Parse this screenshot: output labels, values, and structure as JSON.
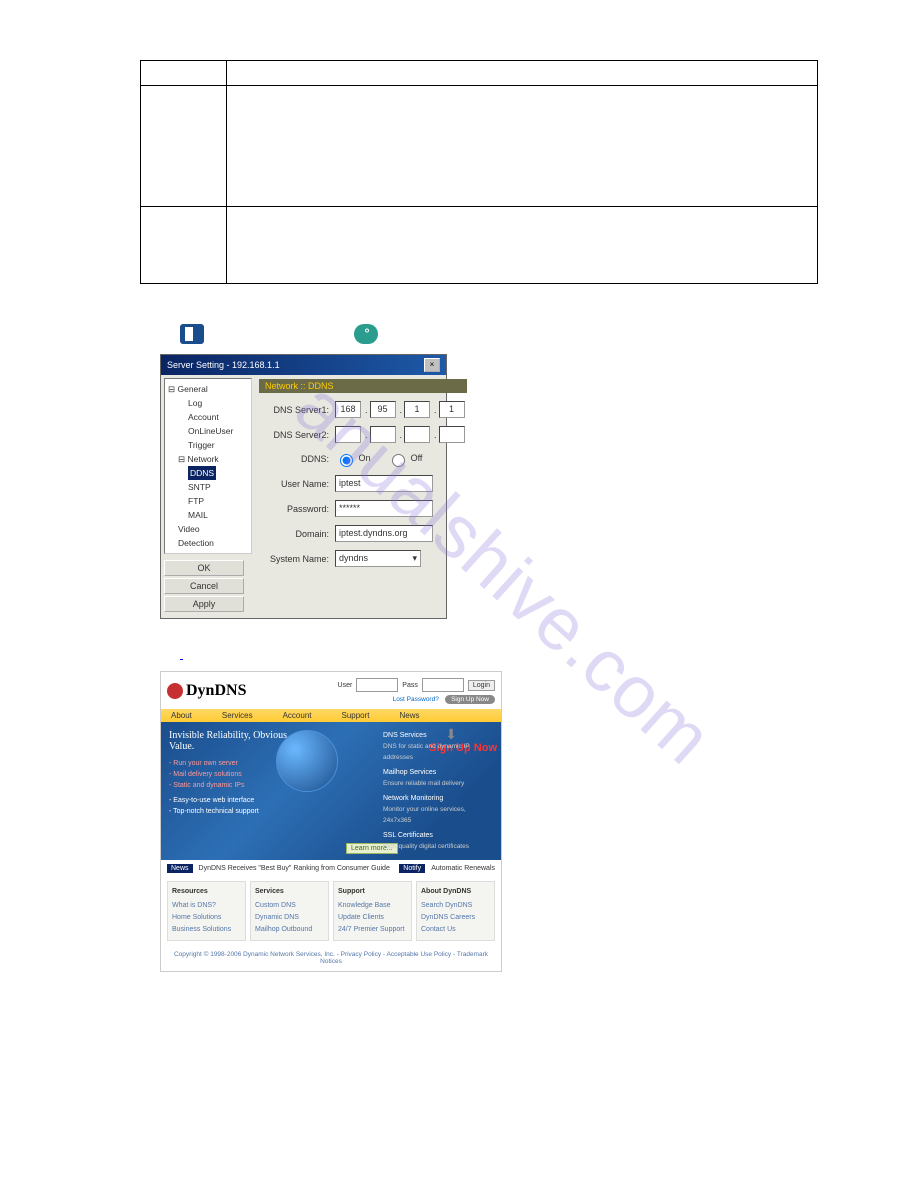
{
  "table": {
    "row1": "",
    "row2": ""
  },
  "dialog": {
    "title": "Server Setting - 192.168.1.1",
    "tree": {
      "general": "General",
      "log": "Log",
      "account": "Account",
      "onlineuser": "OnLineUser",
      "trigger": "Trigger",
      "network": "Network",
      "ddns": "DDNS",
      "sntp": "SNTP",
      "ftp": "FTP",
      "mail": "MAIL",
      "video": "Video",
      "detection": "Detection"
    },
    "form_header": "Network :: DDNS",
    "labels": {
      "dns1": "DNS Server1:",
      "dns2": "DNS Server2:",
      "ddns": "DDNS:",
      "username": "User Name:",
      "password": "Password:",
      "domain": "Domain:",
      "sysname": "System Name:"
    },
    "values": {
      "dns1": [
        "168",
        "95",
        "1",
        "1"
      ],
      "on": "On",
      "off": "Off",
      "username": "iptest",
      "password": "******",
      "domain": "iptest.dyndns.org",
      "sysname": "dyndns"
    },
    "buttons": {
      "ok": "OK",
      "cancel": "Cancel",
      "apply": "Apply"
    }
  },
  "website": {
    "logo": "DynDNS",
    "login": {
      "user": "User",
      "pass": "Pass",
      "login": "Login",
      "lost": "Lost Password?",
      "signup": "Sign Up Now"
    },
    "nav": [
      "About",
      "Services",
      "Account",
      "Support",
      "News"
    ],
    "banner": {
      "title": "Invisible Reliability, Obvious Value.",
      "items": [
        "Run your own server",
        "Mail delivery solutions",
        "Static and dynamic IPs",
        "Easy-to-use web interface",
        "Top-notch technical support"
      ],
      "learn": "Learn more...",
      "signup_big": "Sign Up Now"
    },
    "services": {
      "dns": {
        "h": "DNS Services",
        "t": "DNS for static and dynamic IP addresses"
      },
      "mail": {
        "h": "Mailhop Services",
        "t": "Ensure reliable mail delivery"
      },
      "monitor": {
        "h": "Network Monitoring",
        "t": "Monitor your online services, 24x7x365"
      },
      "ssl": {
        "h": "SSL Certificates",
        "t": "High-quality digital certificates"
      }
    },
    "news": {
      "tag": "News",
      "text": "DynDNS Receives \"Best Buy\" Ranking from Consumer Guide",
      "notify": "Notify",
      "auto": "Automatic Renewals"
    },
    "cols": {
      "resources": {
        "h": "Resources",
        "i": [
          "What is DNS?",
          "Home Solutions",
          "Business Solutions"
        ]
      },
      "services": {
        "h": "Services",
        "i": [
          "Custom DNS",
          "Dynamic DNS",
          "Mailhop Outbound"
        ]
      },
      "support": {
        "h": "Support",
        "i": [
          "Knowledge Base",
          "Update Clients",
          "24/7 Premier Support"
        ]
      },
      "about": {
        "h": "About DynDNS",
        "i": [
          "Search DynDNS",
          "DynDNS Careers",
          "Contact Us"
        ]
      }
    },
    "copyright": "Copyright © 1998-2006 Dynamic Network Services, Inc. - Privacy Policy - Acceptable Use Policy - Trademark Notices"
  },
  "watermark": "anualshive.com"
}
